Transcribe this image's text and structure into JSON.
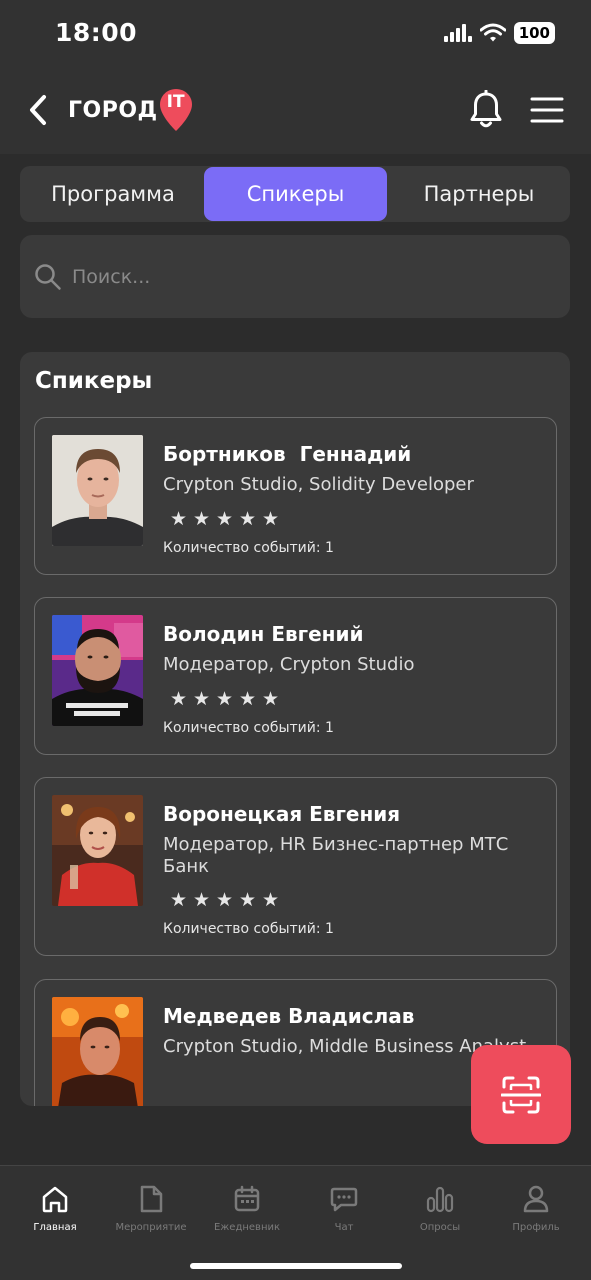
{
  "status_bar": {
    "time": "18:00",
    "battery": "100"
  },
  "header": {
    "logo_text": "ГОРОД",
    "logo_badge": "IT",
    "brand_color": "#ee4c5c"
  },
  "tabs": [
    {
      "label": "Программа",
      "active": false
    },
    {
      "label": "Спикеры",
      "active": true
    },
    {
      "label": "Партнеры",
      "active": false
    }
  ],
  "accent_color": "#7b6cf6",
  "search": {
    "placeholder": "Поиск..."
  },
  "speakers_section": {
    "title": "Спикеры",
    "items": [
      {
        "name": "Бортников  Геннадий",
        "role": "Crypton Studio, Solidity Developer",
        "rating_stars": 5,
        "events_label": "Количество событий: 1"
      },
      {
        "name": "Володин Евгений",
        "role": "Модератор, Crypton Studio",
        "rating_stars": 5,
        "events_label": "Количество событий: 1"
      },
      {
        "name": "Воронецкая Евгения",
        "role": "Модератор, HR Бизнес-партнер МТС Банк",
        "rating_stars": 5,
        "events_label": "Количество событий: 1"
      },
      {
        "name": "Медведев Владислав",
        "role": "Crypton Studio, Middle Business Analyst"
      }
    ]
  },
  "scan_button": {
    "icon": "scan-icon",
    "color": "#ee4c5c"
  },
  "bottom_nav": {
    "items": [
      {
        "label": "Главная",
        "icon": "home-icon",
        "active": true
      },
      {
        "label": "Мероприятие",
        "icon": "document-icon",
        "active": false
      },
      {
        "label": "Ежедневник",
        "icon": "calendar-icon",
        "active": false
      },
      {
        "label": "Чат",
        "icon": "chat-icon",
        "active": false
      },
      {
        "label": "Опросы",
        "icon": "bar-chart-icon",
        "active": false
      },
      {
        "label": "Профиль",
        "icon": "user-icon",
        "active": false
      }
    ]
  }
}
